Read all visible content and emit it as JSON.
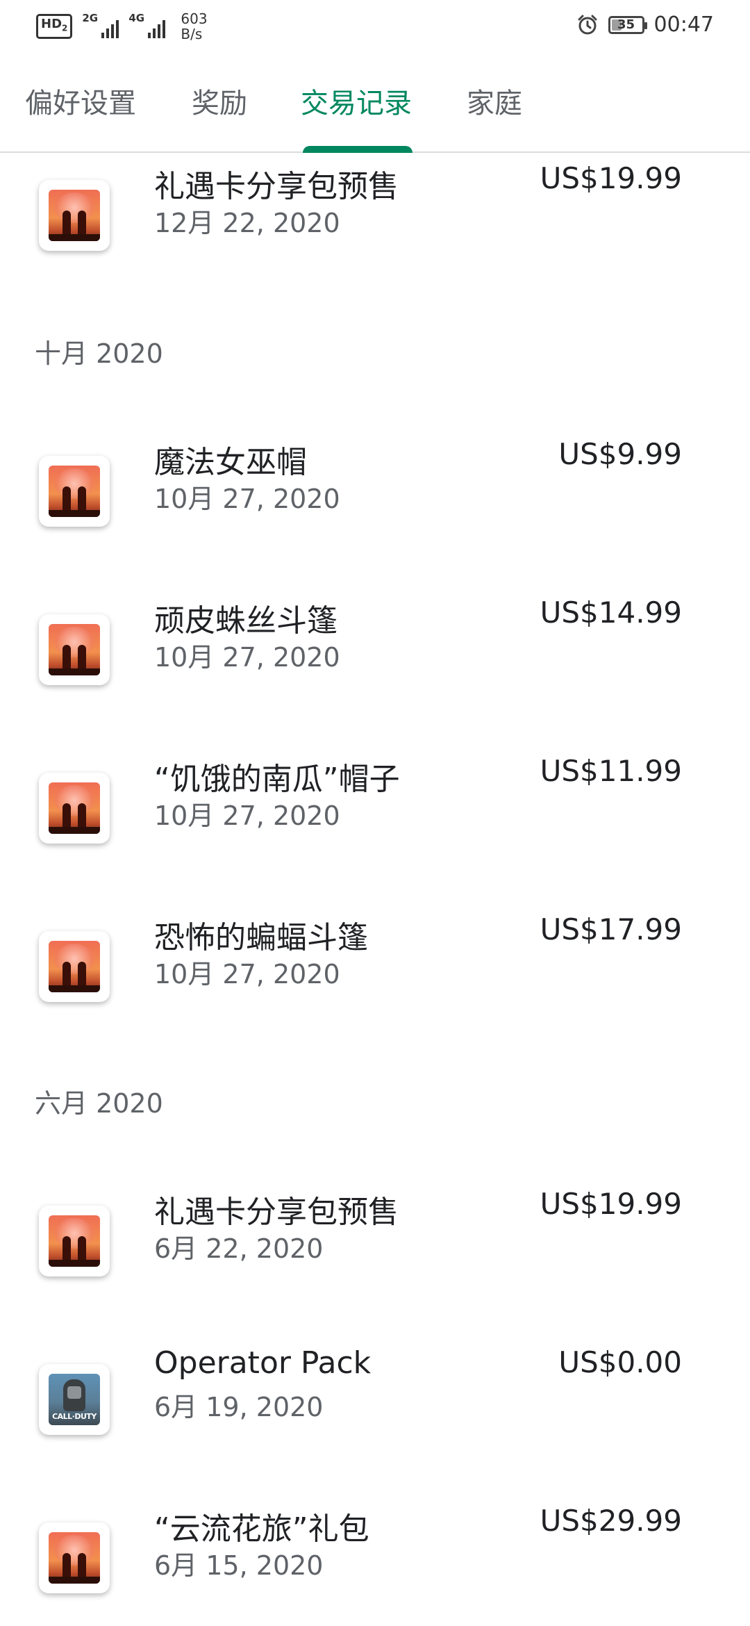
{
  "status_bar": {
    "hd_badge": "HD",
    "hd_sub": "2",
    "net1_label": "2G",
    "net2_label": "4G",
    "speed_value": "603",
    "speed_unit": "B/s",
    "battery_level": "35",
    "time": "00:47"
  },
  "tabs": [
    {
      "label": "偏好设置",
      "active": false
    },
    {
      "label": "奖励",
      "active": false
    },
    {
      "label": "交易记录",
      "active": true
    },
    {
      "label": "家庭",
      "active": false
    }
  ],
  "accent_color": "#01875f",
  "transactions_top": [
    {
      "title": "礼遇卡分享包预售",
      "date": "12月 22, 2020",
      "price": "US$19.99",
      "icon": "sky-game-icon"
    }
  ],
  "sections": [
    {
      "header": "十月 2020",
      "items": [
        {
          "title": "魔法女巫帽",
          "date": "10月 27, 2020",
          "price": "US$9.99",
          "icon": "sky-game-icon"
        },
        {
          "title": "顽皮蛛丝斗篷",
          "date": "10月 27, 2020",
          "price": "US$14.99",
          "icon": "sky-game-icon"
        },
        {
          "title": "“饥饿的南瓜”帽子",
          "date": "10月 27, 2020",
          "price": "US$11.99",
          "icon": "sky-game-icon"
        },
        {
          "title": "恐怖的蝙蝠斗篷",
          "date": "10月 27, 2020",
          "price": "US$17.99",
          "icon": "sky-game-icon"
        }
      ]
    },
    {
      "header": "六月 2020",
      "items": [
        {
          "title": "礼遇卡分享包预售",
          "date": "6月 22, 2020",
          "price": "US$19.99",
          "icon": "sky-game-icon"
        },
        {
          "title": "Operator Pack",
          "date": "6月 19, 2020",
          "price": "US$0.00",
          "icon": "call-of-duty-icon",
          "icon_text": "CALL·DUTY"
        },
        {
          "title": "“云流花旅”礼包",
          "date": "6月 15, 2020",
          "price": "US$29.99",
          "icon": "sky-game-icon"
        }
      ]
    }
  ]
}
